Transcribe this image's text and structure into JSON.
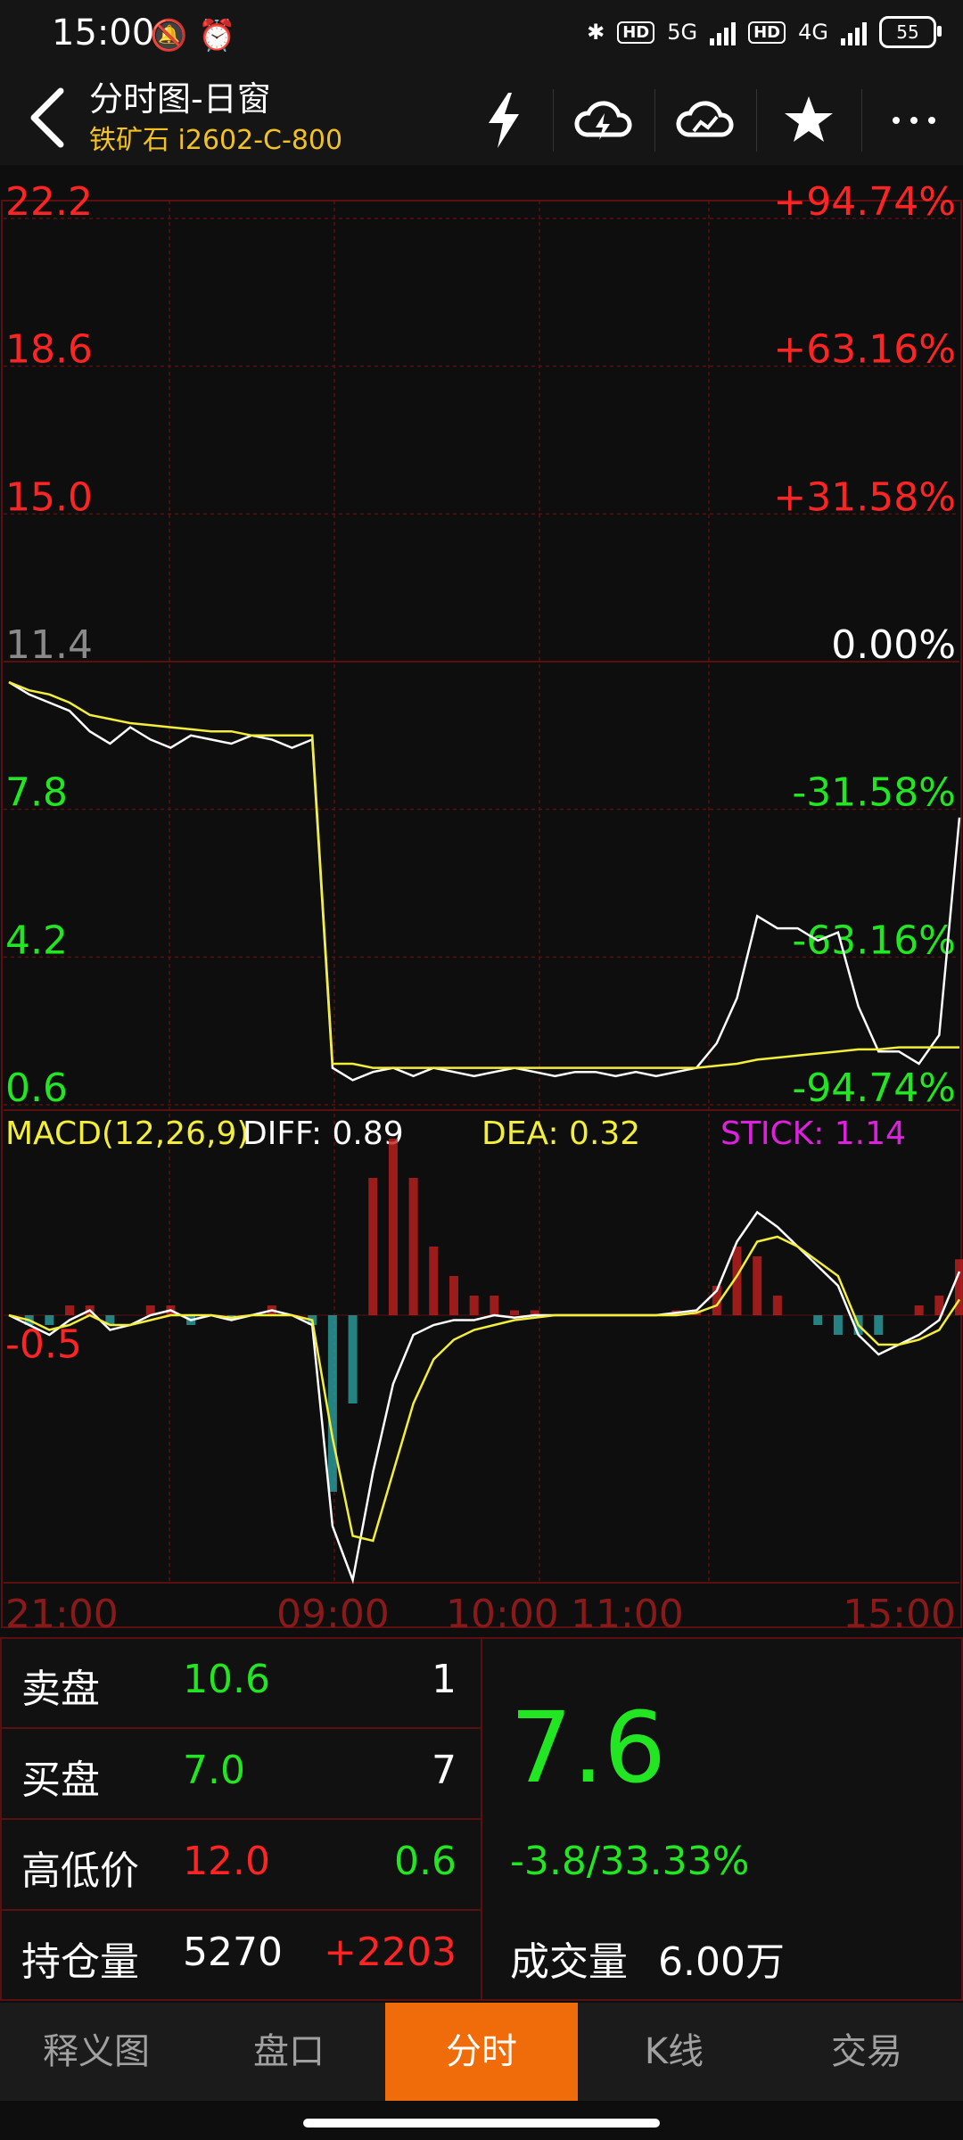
{
  "status": {
    "time": "15:00",
    "net1": "5G",
    "net2": "4G",
    "hd": "HD",
    "battery": "55"
  },
  "header": {
    "title": "分时图-日窗",
    "subtitle": "铁矿石 i2602-C-800"
  },
  "price_axis": {
    "left": [
      "22.2",
      "18.6",
      "15.0",
      "11.4",
      "7.8",
      "4.2",
      "0.6"
    ],
    "right": [
      "+94.74%",
      "+63.16%",
      "+31.58%",
      "0.00%",
      "-31.58%",
      "-63.16%",
      "-94.74%"
    ]
  },
  "macd": {
    "label": "MACD(12,26,9)",
    "diff": "DIFF: 0.89",
    "dea": "DEA: 0.32",
    "stick": "STICK: 1.14",
    "axis_value": "-0.5"
  },
  "time_axis": [
    "21:00",
    "09:00",
    "10:00",
    "11:00",
    "15:00"
  ],
  "quote": {
    "sell_label": "卖盘",
    "sell_price": "10.6",
    "sell_vol": "1",
    "buy_label": "买盘",
    "buy_price": "7.0",
    "buy_vol": "7",
    "hl_label": "高低价",
    "high": "12.0",
    "low": "0.6",
    "oi_label": "持仓量",
    "oi": "5270",
    "oi_change": "+2203",
    "last": "7.6",
    "change": "-3.8/33.33%",
    "volume_label": "成交量",
    "volume": "6.00万"
  },
  "tabs": [
    "释义图",
    "盘口",
    "分时",
    "K线",
    "交易"
  ],
  "active_tab": 2,
  "chart_data": {
    "type": "line",
    "x_ticks": [
      "21:00",
      "09:00",
      "10:00",
      "11:00",
      "15:00"
    ],
    "ylim": [
      0.6,
      22.2
    ],
    "reference_price": 11.4,
    "series": [
      {
        "values": [
          10.9,
          10.6,
          10.4,
          10.2,
          9.7,
          9.4,
          9.8,
          9.5,
          9.3,
          9.6,
          9.5,
          9.4,
          9.6,
          9.5,
          9.3,
          9.5,
          1.5,
          1.2,
          1.4,
          1.5,
          1.3,
          1.5,
          1.4,
          1.3,
          1.4,
          1.5,
          1.4,
          1.3,
          1.4,
          1.4,
          1.3,
          1.4,
          1.3,
          1.4,
          1.5,
          2.1,
          3.2,
          5.2,
          4.9,
          4.9,
          4.6,
          4.8,
          3.0,
          1.9,
          1.9,
          1.6,
          2.3,
          7.6
        ]
      },
      {
        "values": [
          10.9,
          10.7,
          10.6,
          10.4,
          10.1,
          10.0,
          9.9,
          9.85,
          9.8,
          9.75,
          9.7,
          9.7,
          9.6,
          9.6,
          9.6,
          9.6,
          1.6,
          1.6,
          1.5,
          1.5,
          1.5,
          1.5,
          1.5,
          1.5,
          1.5,
          1.5,
          1.5,
          1.5,
          1.5,
          1.5,
          1.5,
          1.5,
          1.5,
          1.5,
          1.5,
          1.55,
          1.6,
          1.7,
          1.75,
          1.8,
          1.85,
          1.9,
          1.95,
          1.95,
          2.0,
          2.0,
          2.0,
          2.0
        ]
      }
    ],
    "macd_diff": [
      0,
      -0.2,
      -0.4,
      -0.1,
      0.1,
      -0.3,
      -0.2,
      0,
      0.1,
      -0.1,
      0,
      -0.1,
      0,
      0.1,
      0,
      -0.2,
      -4.3,
      -5.4,
      -3.2,
      -1.4,
      -0.4,
      -0.2,
      -0.1,
      -0.1,
      0,
      -0.05,
      0,
      0,
      0,
      0,
      0,
      0,
      0,
      0.05,
      0.1,
      0.5,
      1.5,
      2.1,
      1.8,
      1.4,
      1.0,
      0.6,
      -0.4,
      -0.8,
      -0.6,
      -0.4,
      -0.1,
      0.89
    ],
    "macd_dea": [
      0,
      -0.1,
      -0.3,
      -0.2,
      0,
      -0.2,
      -0.2,
      -0.1,
      0,
      0,
      0,
      -0.05,
      0,
      0,
      0,
      -0.1,
      -2.5,
      -4.5,
      -4.6,
      -3.2,
      -1.8,
      -0.9,
      -0.5,
      -0.3,
      -0.2,
      -0.1,
      -0.05,
      0,
      0,
      0,
      0,
      0,
      0,
      0,
      0.05,
      0.2,
      0.8,
      1.5,
      1.6,
      1.4,
      1.1,
      0.8,
      -0.2,
      -0.6,
      -0.6,
      -0.5,
      -0.3,
      0.32
    ]
  }
}
